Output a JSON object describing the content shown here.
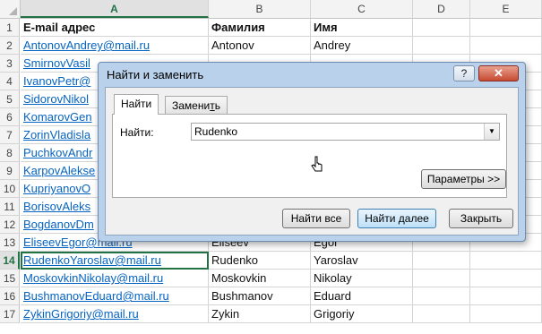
{
  "columns": [
    "A",
    "B",
    "C",
    "D",
    "E"
  ],
  "selected_column": "A",
  "rows": [
    {
      "num": "1",
      "a": "E-mail адрес",
      "b": "Фамилия",
      "c": "Имя",
      "header": true
    },
    {
      "num": "2",
      "a": "AntonovAndrey@mail.ru",
      "b": "Antonov",
      "c": "Andrey"
    },
    {
      "num": "3",
      "a": "SmirnovVasil",
      "b": "",
      "c": ""
    },
    {
      "num": "4",
      "a": "IvanovPetr@",
      "b": "",
      "c": ""
    },
    {
      "num": "5",
      "a": "SidorovNikol",
      "b": "",
      "c": ""
    },
    {
      "num": "6",
      "a": "KomarovGen",
      "b": "",
      "c": ""
    },
    {
      "num": "7",
      "a": "ZorinVladisla",
      "b": "",
      "c": ""
    },
    {
      "num": "8",
      "a": "PuchkovAndr",
      "b": "",
      "c": ""
    },
    {
      "num": "9",
      "a": "KarpovAlekse",
      "b": "",
      "c": ""
    },
    {
      "num": "10",
      "a": "KupriyanovO",
      "b": "",
      "c": ""
    },
    {
      "num": "11",
      "a": "BorisovAleks",
      "b": "",
      "c": ""
    },
    {
      "num": "12",
      "a": "BogdanovDm",
      "b": "",
      "c": ""
    },
    {
      "num": "13",
      "a": "EliseevEgor@mail.ru",
      "b": "Eliseev",
      "c": "Egor"
    },
    {
      "num": "14",
      "a": "RudenkoYaroslav@mail.ru",
      "b": "Rudenko",
      "c": "Yaroslav",
      "active": true
    },
    {
      "num": "15",
      "a": "MoskovkinNikolay@mail.ru",
      "b": "Moskovkin",
      "c": "Nikolay"
    },
    {
      "num": "16",
      "a": "BushmanovEduard@mail.ru",
      "b": "Bushmanov",
      "c": "Eduard"
    },
    {
      "num": "17",
      "a": "ZykinGrigoriy@mail.ru",
      "b": "Zykin",
      "c": "Grigoriy"
    }
  ],
  "dialog": {
    "title": "Найти и заменить",
    "help": "?",
    "close": "✕",
    "tab_find": "Найти",
    "tab_replace_pre": "Замени",
    "tab_replace_u": "т",
    "tab_replace_post": "ь",
    "find_label": "Найти:",
    "find_value": "Rudenko",
    "dropdown_icon": "▼",
    "options_button": "Параметры >>",
    "find_all_button": "Найти все",
    "find_next_button": "Найти далее",
    "close_button": "Закрыть"
  },
  "colors": {
    "excel_green": "#217346",
    "link": "#0563c1"
  }
}
